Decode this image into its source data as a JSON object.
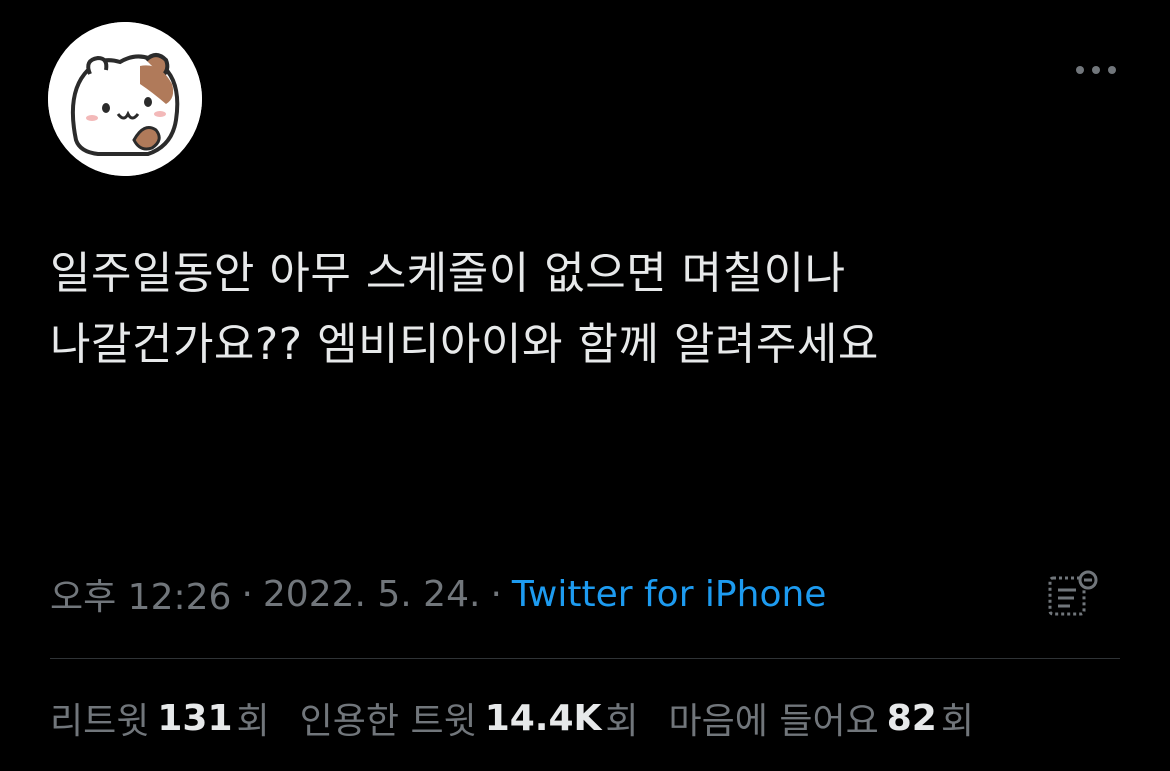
{
  "tweet": {
    "avatar_icon": "cartoon-hamster-avatar-icon",
    "more_icon": "more-options-icon",
    "text": "일주일동안 아무 스케줄이 없으면 며칠이나 나갈건가요?? 엠비티아이와 함께 알려주세요",
    "meta": {
      "time": "오후 12:26",
      "date": "2022. 5. 24.",
      "separator": "·",
      "source": "Twitter for iPhone"
    },
    "analytics_icon": "analytics-icon",
    "stats": {
      "retweets_label": "리트윗",
      "retweets_value": "131",
      "retweets_unit": "회",
      "quotes_label": "인용한 트윗",
      "quotes_value": "14.4K",
      "quotes_unit": "회",
      "likes_label": "마음에 들어요",
      "likes_value": "82",
      "likes_unit": "회"
    }
  },
  "colors": {
    "background": "#000000",
    "text": "#e7e9ea",
    "secondary": "#71767b",
    "link": "#1d9bf0",
    "divider": "#2f3336"
  }
}
